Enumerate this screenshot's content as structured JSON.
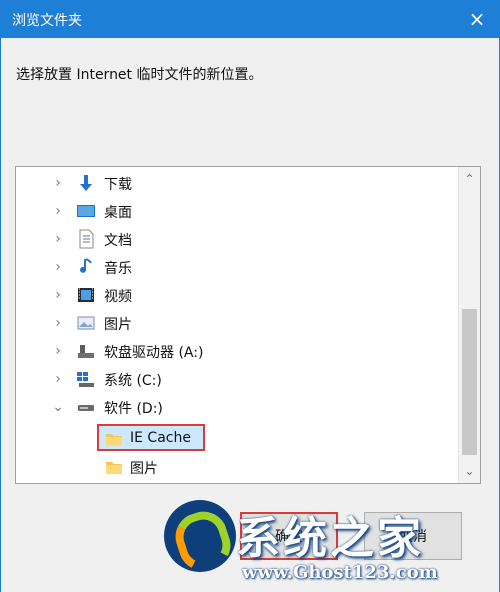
{
  "window": {
    "title": "浏览文件夹",
    "close_glyph": "×"
  },
  "prompt": "选择放置 Internet 临时文件的新位置。",
  "tree": {
    "items": [
      {
        "label": "下载",
        "icon": "download-icon",
        "chevron": "›"
      },
      {
        "label": "桌面",
        "icon": "desktop-icon",
        "chevron": "›"
      },
      {
        "label": "文档",
        "icon": "document-icon",
        "chevron": "›"
      },
      {
        "label": "音乐",
        "icon": "music-icon",
        "chevron": "›"
      },
      {
        "label": "视频",
        "icon": "video-icon",
        "chevron": "›"
      },
      {
        "label": "图片",
        "icon": "pictures-icon",
        "chevron": "›"
      },
      {
        "label": "软盘驱动器 (A:)",
        "icon": "floppy-icon",
        "chevron": "›"
      },
      {
        "label": "系统 (C:)",
        "icon": "system-drive-icon",
        "chevron": "›"
      },
      {
        "label": "软件 (D:)",
        "icon": "drive-icon",
        "chevron": "⌄"
      },
      {
        "label": "IE Cache",
        "icon": "folder-icon",
        "chevron": ""
      },
      {
        "label": "图片",
        "icon": "folder-icon",
        "chevron": ""
      }
    ]
  },
  "buttons": {
    "ok_label": "确定",
    "cancel_label": "取消"
  },
  "scroll": {
    "up": "⌃",
    "down": "⌄"
  },
  "watermark": {
    "text": "系统之家",
    "url": "www.Ghost123.com"
  },
  "colors": {
    "titlebar": "#1e7fd6",
    "selected": "#cce8ff",
    "highlight": "#d83b3b"
  }
}
